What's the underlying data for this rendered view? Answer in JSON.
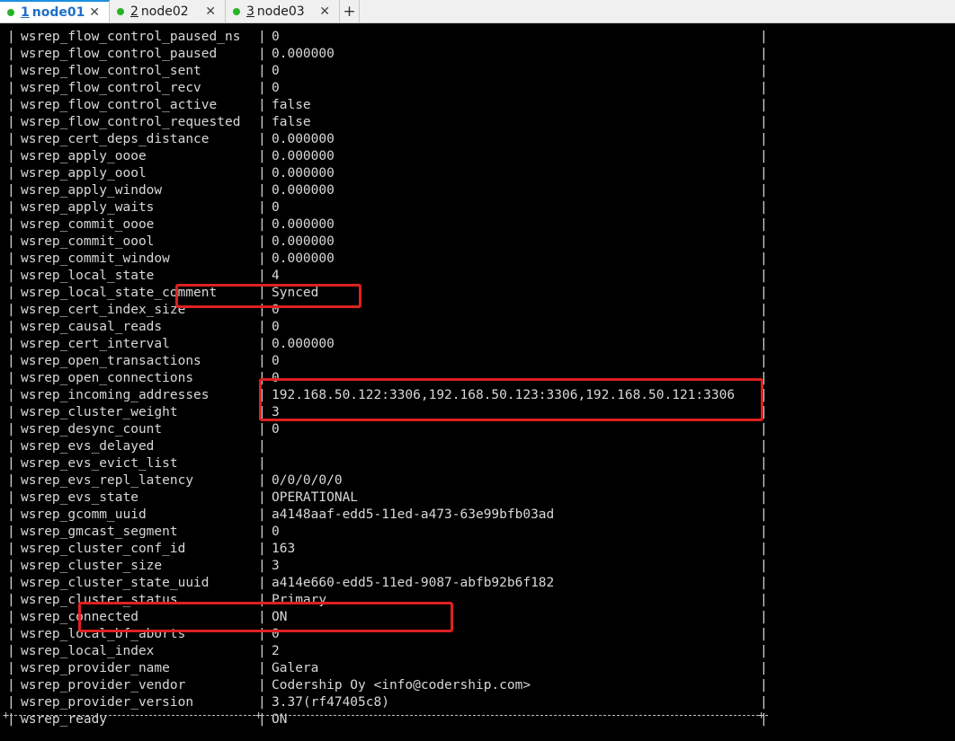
{
  "tabs": [
    {
      "num": "1",
      "label": "node01",
      "active": true,
      "close": "✕"
    },
    {
      "num": "2",
      "label": "node02",
      "active": false,
      "close": "✕"
    },
    {
      "num": "3",
      "label": "node03",
      "active": false,
      "close": "✕"
    }
  ],
  "add_tab": "+",
  "border_char": "|",
  "status_rows": [
    {
      "name": "wsrep_flow_control_paused_ns",
      "value": "0"
    },
    {
      "name": "wsrep_flow_control_paused",
      "value": "0.000000"
    },
    {
      "name": "wsrep_flow_control_sent",
      "value": "0"
    },
    {
      "name": "wsrep_flow_control_recv",
      "value": "0"
    },
    {
      "name": "wsrep_flow_control_active",
      "value": "false"
    },
    {
      "name": "wsrep_flow_control_requested",
      "value": "false"
    },
    {
      "name": "wsrep_cert_deps_distance",
      "value": "0.000000"
    },
    {
      "name": "wsrep_apply_oooe",
      "value": "0.000000"
    },
    {
      "name": "wsrep_apply_oool",
      "value": "0.000000"
    },
    {
      "name": "wsrep_apply_window",
      "value": "0.000000"
    },
    {
      "name": "wsrep_apply_waits",
      "value": "0"
    },
    {
      "name": "wsrep_commit_oooe",
      "value": "0.000000"
    },
    {
      "name": "wsrep_commit_oool",
      "value": "0.000000"
    },
    {
      "name": "wsrep_commit_window",
      "value": "0.000000"
    },
    {
      "name": "wsrep_local_state",
      "value": "4"
    },
    {
      "name": "wsrep_local_state_comment",
      "value": "Synced"
    },
    {
      "name": "wsrep_cert_index_size",
      "value": "0"
    },
    {
      "name": "wsrep_causal_reads",
      "value": "0"
    },
    {
      "name": "wsrep_cert_interval",
      "value": "0.000000"
    },
    {
      "name": "wsrep_open_transactions",
      "value": "0"
    },
    {
      "name": "wsrep_open_connections",
      "value": "0"
    },
    {
      "name": "wsrep_incoming_addresses",
      "value": "192.168.50.122:3306,192.168.50.123:3306,192.168.50.121:3306"
    },
    {
      "name": "wsrep_cluster_weight",
      "value": "3"
    },
    {
      "name": "wsrep_desync_count",
      "value": "0"
    },
    {
      "name": "wsrep_evs_delayed",
      "value": ""
    },
    {
      "name": "wsrep_evs_evict_list",
      "value": ""
    },
    {
      "name": "wsrep_evs_repl_latency",
      "value": "0/0/0/0/0"
    },
    {
      "name": "wsrep_evs_state",
      "value": "OPERATIONAL"
    },
    {
      "name": "wsrep_gcomm_uuid",
      "value": "a4148aaf-edd5-11ed-a473-63e99bfb03ad"
    },
    {
      "name": "wsrep_gmcast_segment",
      "value": "0"
    },
    {
      "name": "wsrep_cluster_conf_id",
      "value": "163"
    },
    {
      "name": "wsrep_cluster_size",
      "value": "3"
    },
    {
      "name": "wsrep_cluster_state_uuid",
      "value": "a414e660-edd5-11ed-9087-abfb92b6f182"
    },
    {
      "name": "wsrep_cluster_status",
      "value": "Primary"
    },
    {
      "name": "wsrep_connected",
      "value": "ON"
    },
    {
      "name": "wsrep_local_bf_aborts",
      "value": "0"
    },
    {
      "name": "wsrep_local_index",
      "value": "2"
    },
    {
      "name": "wsrep_provider_name",
      "value": "Galera"
    },
    {
      "name": "wsrep_provider_vendor",
      "value": "Codership Oy <info@codership.com>"
    },
    {
      "name": "wsrep_provider_version",
      "value": "3.37(rf47405c8)"
    },
    {
      "name": "wsrep_ready",
      "value": "ON"
    }
  ],
  "table_corner": "+",
  "colors": {
    "highlight": "#e02020",
    "tab_active_text": "#1e6fc8",
    "status_dot": "#27b227",
    "terminal_bg": "#000000",
    "terminal_text": "#d8d8d8"
  }
}
